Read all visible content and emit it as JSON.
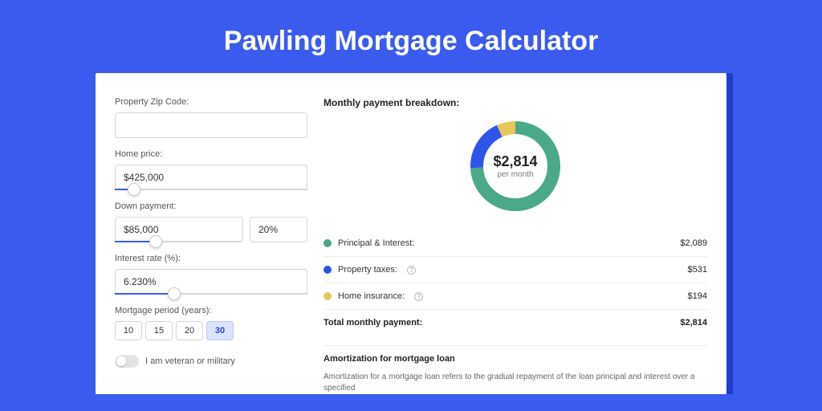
{
  "title": "Pawling Mortgage Calculator",
  "form": {
    "zip_label": "Property Zip Code:",
    "zip_value": "",
    "home_price_label": "Home price:",
    "home_price_value": "$425,000",
    "down_payment_label": "Down payment:",
    "down_payment_value": "$85,000",
    "down_payment_pct": "20%",
    "interest_label": "Interest rate (%):",
    "interest_value": "6.230%",
    "period_label": "Mortgage period (years):",
    "periods": [
      "10",
      "15",
      "20",
      "30"
    ],
    "period_active": "30",
    "veteran_label": "I am veteran or military"
  },
  "breakdown": {
    "heading": "Monthly payment breakdown:",
    "center_amount": "$2,814",
    "center_sub": "per month",
    "items": [
      {
        "label": "Principal & Interest:",
        "value": "$2,089",
        "color": "#4aa986",
        "info": false
      },
      {
        "label": "Property taxes:",
        "value": "$531",
        "color": "#2f54eb",
        "info": true
      },
      {
        "label": "Home insurance:",
        "value": "$194",
        "color": "#e7c65a",
        "info": true
      }
    ],
    "total_label": "Total monthly payment:",
    "total_value": "$2,814"
  },
  "amort": {
    "heading": "Amortization for mortgage loan",
    "text": "Amortization for a mortgage loan refers to the gradual repayment of the loan principal and interest over a specified"
  },
  "chart_data": {
    "type": "pie",
    "title": "Monthly payment breakdown",
    "categories": [
      "Principal & Interest",
      "Property taxes",
      "Home insurance"
    ],
    "values": [
      2089,
      531,
      194
    ],
    "colors": [
      "#4aa986",
      "#2f54eb",
      "#e7c65a"
    ],
    "total": 2814,
    "center_label": "$2,814 per month"
  }
}
